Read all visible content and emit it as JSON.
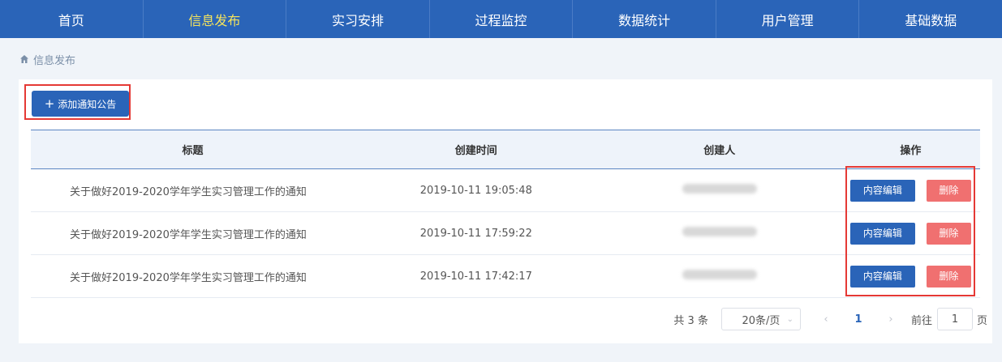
{
  "nav": {
    "items": [
      "首页",
      "信息发布",
      "实习安排",
      "过程监控",
      "数据统计",
      "用户管理",
      "基础数据"
    ],
    "active_index": 1
  },
  "breadcrumb": {
    "label": "信息发布",
    "icon": "home-icon"
  },
  "toolbar": {
    "add_label": "添加通知公告",
    "add_icon": "plus-icon"
  },
  "table": {
    "headers": [
      "标题",
      "创建时间",
      "创建人",
      "操作"
    ],
    "rows": [
      {
        "title": "关于做好2019-2020学年学生实习管理工作的通知",
        "time": "2019-10-11 19:05:48",
        "creator": ""
      },
      {
        "title": "关于做好2019-2020学年学生实习管理工作的通知",
        "time": "2019-10-11 17:59:22",
        "creator": ""
      },
      {
        "title": "关于做好2019-2020学年学生实习管理工作的通知",
        "time": "2019-10-11 17:42:17",
        "creator": ""
      }
    ],
    "edit_label": "内容编辑",
    "delete_label": "删除"
  },
  "pager": {
    "total": "共 3 条",
    "page_size": "20条/页",
    "current_page": "1",
    "goto_label": "前往",
    "goto_value": "1",
    "page_unit": "页"
  },
  "colors": {
    "primary": "#2a64b8",
    "active_nav": "#f5e35c",
    "danger": "#f07070",
    "highlight": "#e53935"
  }
}
